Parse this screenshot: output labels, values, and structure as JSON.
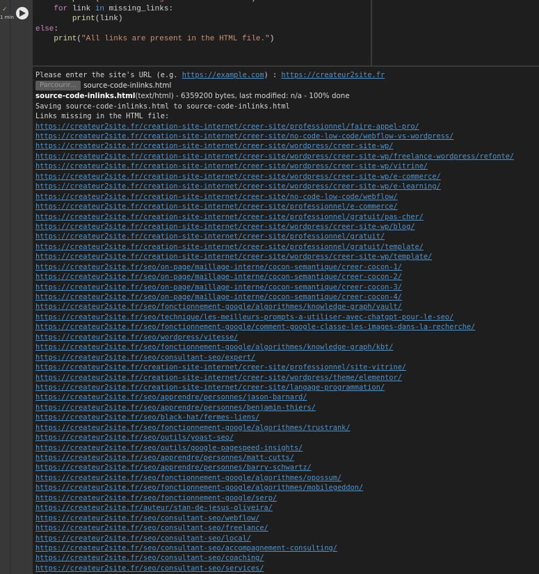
{
  "cell": {
    "status_icon": "check-icon",
    "exec_time": "1 min",
    "code_lines": [
      {
        "parts": [
          [
            "",
            "        "
          ],
          [
            "fn",
            "print"
          ],
          [
            "",
            "("
          ],
          [
            "st",
            "\"Links missing in the HTML file:\""
          ],
          [
            "",
            ")"
          ]
        ]
      },
      {
        "parts": [
          [
            "",
            "    "
          ],
          [
            "kw",
            "for"
          ],
          [
            "",
            " link "
          ],
          [
            "kb",
            "in"
          ],
          [
            "",
            " missing_links:"
          ]
        ]
      },
      {
        "parts": [
          [
            "",
            "        "
          ],
          [
            "fn",
            "print"
          ],
          [
            "",
            "(link)"
          ]
        ]
      },
      {
        "parts": [
          [
            "kw",
            "else"
          ],
          [
            "",
            ":"
          ]
        ]
      },
      {
        "parts": [
          [
            "",
            "    "
          ],
          [
            "fn",
            "print"
          ],
          [
            "",
            "("
          ],
          [
            "st",
            "\"All links are present in the HTML file.\""
          ],
          [
            "",
            ")"
          ]
        ]
      }
    ]
  },
  "output": {
    "prompt_text": "Please enter the site's URL (e.g. ",
    "prompt_example": "https://example.com",
    "prompt_suffix": ") : ",
    "prompt_value": "https://createur2site.fr",
    "browse_label": "Parcourir...",
    "uploaded_file": "source-code-inlinks.html",
    "file_name": "source-code-inlinks.html",
    "file_meta": "(text/html) - 6359200 bytes, last modified: n/a - 100% done",
    "saving_line": "Saving source-code-inlinks.html to source-code-inlinks.html",
    "missing_header": "Links missing in the HTML file:",
    "links": [
      "https://createur2site.fr/creation-site-internet/creer-site/professionnel/faire-appel-pro/",
      "https://createur2site.fr/creation-site-internet/creer-site/no-code-low-code/webflow-vs-wordpress/",
      "https://createur2site.fr/creation-site-internet/creer-site/wordpress/creer-site-wp/",
      "https://createur2site.fr/creation-site-internet/creer-site/wordpress/creer-site-wp/freelance-wordpress/refonte/",
      "https://createur2site.fr/creation-site-internet/creer-site/wordpress/creer-site-wp/vitrine/",
      "https://createur2site.fr/creation-site-internet/creer-site/wordpress/creer-site-wp/e-commerce/",
      "https://createur2site.fr/creation-site-internet/creer-site/wordpress/creer-site-wp/e-learning/",
      "https://createur2site.fr/creation-site-internet/creer-site/no-code-low-code/webflow/",
      "https://createur2site.fr/creation-site-internet/creer-site/professionnel/e-commerce/",
      "https://createur2site.fr/creation-site-internet/creer-site/professionnel/gratuit/pas-cher/",
      "https://createur2site.fr/creation-site-internet/creer-site/wordpress/creer-site-wp/blog/",
      "https://createur2site.fr/creation-site-internet/creer-site/professionnel/gratuit/",
      "https://createur2site.fr/creation-site-internet/creer-site/professionnel/gratuit/template/",
      "https://createur2site.fr/creation-site-internet/creer-site/wordpress/creer-site-wp/template/",
      "https://createur2site.fr/seo/on-page/maillage-interne/cocon-semantique/creer-cocon-1/",
      "https://createur2site.fr/seo/on-page/maillage-interne/cocon-semantique/creer-cocon-2/",
      "https://createur2site.fr/seo/on-page/maillage-interne/cocon-semantique/creer-cocon-3/",
      "https://createur2site.fr/seo/on-page/maillage-interne/cocon-semantique/creer-cocon-4/",
      "https://createur2site.fr/seo/fonctionnement-google/algorithmes/knowledge-graph/vault/",
      "https://createur2site.fr/seo/technique/les-meilleurs-prompts-a-utiliser-avec-chatgpt-pour-le-seo/",
      "https://createur2site.fr/seo/fonctionnement-google/comment-google-classe-les-images-dans-la-recherche/",
      "https://createur2site.fr/seo/wordpress/vitesse/",
      "https://createur2site.fr/seo/fonctionnement-google/algorithmes/knowledge-graph/kbt/",
      "https://createur2site.fr/seo/consultant-seo/expert/",
      "https://createur2site.fr/creation-site-internet/creer-site/professionnel/site-vitrine/",
      "https://createur2site.fr/creation-site-internet/creer-site/wordpress/theme/elementor/",
      "https://createur2site.fr/creation-site-internet/creer-site/langage-programmation/",
      "https://createur2site.fr/seo/apprendre/personnes/jason-barnard/",
      "https://createur2site.fr/seo/apprendre/personnes/benjamin-thiers/",
      "https://createur2site.fr/seo/black-hat/fermes-liens/",
      "https://createur2site.fr/seo/fonctionnement-google/algorithmes/trustrank/",
      "https://createur2site.fr/seo/outils/yoast-seo/",
      "https://createur2site.fr/seo/outils/google-pagespeed-insights/",
      "https://createur2site.fr/seo/apprendre/personnes/matt-cutts/",
      "https://createur2site.fr/seo/apprendre/personnes/barry-schwartz/",
      "https://createur2site.fr/seo/fonctionnement-google/algorithmes/opossum/",
      "https://createur2site.fr/seo/fonctionnement-google/algorithmes/mobilegeddon/",
      "https://createur2site.fr/seo/fonctionnement-google/serp/",
      "https://createur2site.fr/auteur/stan-de-jesus-oliveira/",
      "https://createur2site.fr/seo/consultant-seo/webflow/",
      "https://createur2site.fr/seo/consultant-seo/freelance/",
      "https://createur2site.fr/seo/consultant-seo/local/",
      "https://createur2site.fr/seo/consultant-seo/accompagnement-consulting/",
      "https://createur2site.fr/seo/consultant-seo/coaching/",
      "https://createur2site.fr/seo/consultant-seo/services/"
    ]
  },
  "colors": {
    "link": "#4e94ce",
    "status_ok": "#6fcf6f",
    "background": "#1e1e1e"
  }
}
